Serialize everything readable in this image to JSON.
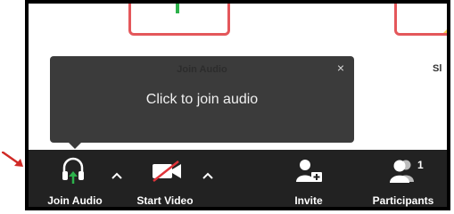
{
  "background": {
    "right_label": "Sl"
  },
  "tooltip": {
    "title": "Join Audio",
    "message": "Click to join audio",
    "close_glyph": "×"
  },
  "toolbar": {
    "join_audio": {
      "label": "Join Audio",
      "icon": "headphones-icon"
    },
    "start_video": {
      "label": "Start Video",
      "icon": "video-off-icon"
    },
    "invite": {
      "label": "Invite",
      "icon": "invite-icon"
    },
    "participants": {
      "label": "Participants",
      "count": "1",
      "icon": "participants-icon"
    }
  },
  "colors": {
    "toolbar_bg": "#222222",
    "tooltip_bg": "#3b3b3b",
    "accent_green": "#2db14b",
    "muted_red": "#e0343a",
    "card_border": "#e4575b",
    "annotation_arrow": "#d02a26"
  }
}
